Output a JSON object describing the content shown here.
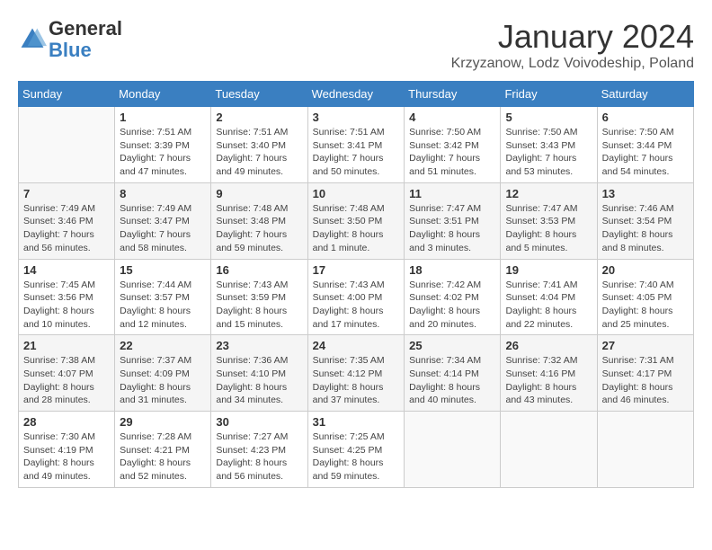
{
  "header": {
    "logo_general": "General",
    "logo_blue": "Blue",
    "month_title": "January 2024",
    "location": "Krzyzanow, Lodz Voivodeship, Poland"
  },
  "weekdays": [
    "Sunday",
    "Monday",
    "Tuesday",
    "Wednesday",
    "Thursday",
    "Friday",
    "Saturday"
  ],
  "weeks": [
    [
      {
        "day": "",
        "sunrise": "",
        "sunset": "",
        "daylight": ""
      },
      {
        "day": "1",
        "sunrise": "Sunrise: 7:51 AM",
        "sunset": "Sunset: 3:39 PM",
        "daylight": "Daylight: 7 hours and 47 minutes."
      },
      {
        "day": "2",
        "sunrise": "Sunrise: 7:51 AM",
        "sunset": "Sunset: 3:40 PM",
        "daylight": "Daylight: 7 hours and 49 minutes."
      },
      {
        "day": "3",
        "sunrise": "Sunrise: 7:51 AM",
        "sunset": "Sunset: 3:41 PM",
        "daylight": "Daylight: 7 hours and 50 minutes."
      },
      {
        "day": "4",
        "sunrise": "Sunrise: 7:50 AM",
        "sunset": "Sunset: 3:42 PM",
        "daylight": "Daylight: 7 hours and 51 minutes."
      },
      {
        "day": "5",
        "sunrise": "Sunrise: 7:50 AM",
        "sunset": "Sunset: 3:43 PM",
        "daylight": "Daylight: 7 hours and 53 minutes."
      },
      {
        "day": "6",
        "sunrise": "Sunrise: 7:50 AM",
        "sunset": "Sunset: 3:44 PM",
        "daylight": "Daylight: 7 hours and 54 minutes."
      }
    ],
    [
      {
        "day": "7",
        "sunrise": "Sunrise: 7:49 AM",
        "sunset": "Sunset: 3:46 PM",
        "daylight": "Daylight: 7 hours and 56 minutes."
      },
      {
        "day": "8",
        "sunrise": "Sunrise: 7:49 AM",
        "sunset": "Sunset: 3:47 PM",
        "daylight": "Daylight: 7 hours and 58 minutes."
      },
      {
        "day": "9",
        "sunrise": "Sunrise: 7:48 AM",
        "sunset": "Sunset: 3:48 PM",
        "daylight": "Daylight: 7 hours and 59 minutes."
      },
      {
        "day": "10",
        "sunrise": "Sunrise: 7:48 AM",
        "sunset": "Sunset: 3:50 PM",
        "daylight": "Daylight: 8 hours and 1 minute."
      },
      {
        "day": "11",
        "sunrise": "Sunrise: 7:47 AM",
        "sunset": "Sunset: 3:51 PM",
        "daylight": "Daylight: 8 hours and 3 minutes."
      },
      {
        "day": "12",
        "sunrise": "Sunrise: 7:47 AM",
        "sunset": "Sunset: 3:53 PM",
        "daylight": "Daylight: 8 hours and 5 minutes."
      },
      {
        "day": "13",
        "sunrise": "Sunrise: 7:46 AM",
        "sunset": "Sunset: 3:54 PM",
        "daylight": "Daylight: 8 hours and 8 minutes."
      }
    ],
    [
      {
        "day": "14",
        "sunrise": "Sunrise: 7:45 AM",
        "sunset": "Sunset: 3:56 PM",
        "daylight": "Daylight: 8 hours and 10 minutes."
      },
      {
        "day": "15",
        "sunrise": "Sunrise: 7:44 AM",
        "sunset": "Sunset: 3:57 PM",
        "daylight": "Daylight: 8 hours and 12 minutes."
      },
      {
        "day": "16",
        "sunrise": "Sunrise: 7:43 AM",
        "sunset": "Sunset: 3:59 PM",
        "daylight": "Daylight: 8 hours and 15 minutes."
      },
      {
        "day": "17",
        "sunrise": "Sunrise: 7:43 AM",
        "sunset": "Sunset: 4:00 PM",
        "daylight": "Daylight: 8 hours and 17 minutes."
      },
      {
        "day": "18",
        "sunrise": "Sunrise: 7:42 AM",
        "sunset": "Sunset: 4:02 PM",
        "daylight": "Daylight: 8 hours and 20 minutes."
      },
      {
        "day": "19",
        "sunrise": "Sunrise: 7:41 AM",
        "sunset": "Sunset: 4:04 PM",
        "daylight": "Daylight: 8 hours and 22 minutes."
      },
      {
        "day": "20",
        "sunrise": "Sunrise: 7:40 AM",
        "sunset": "Sunset: 4:05 PM",
        "daylight": "Daylight: 8 hours and 25 minutes."
      }
    ],
    [
      {
        "day": "21",
        "sunrise": "Sunrise: 7:38 AM",
        "sunset": "Sunset: 4:07 PM",
        "daylight": "Daylight: 8 hours and 28 minutes."
      },
      {
        "day": "22",
        "sunrise": "Sunrise: 7:37 AM",
        "sunset": "Sunset: 4:09 PM",
        "daylight": "Daylight: 8 hours and 31 minutes."
      },
      {
        "day": "23",
        "sunrise": "Sunrise: 7:36 AM",
        "sunset": "Sunset: 4:10 PM",
        "daylight": "Daylight: 8 hours and 34 minutes."
      },
      {
        "day": "24",
        "sunrise": "Sunrise: 7:35 AM",
        "sunset": "Sunset: 4:12 PM",
        "daylight": "Daylight: 8 hours and 37 minutes."
      },
      {
        "day": "25",
        "sunrise": "Sunrise: 7:34 AM",
        "sunset": "Sunset: 4:14 PM",
        "daylight": "Daylight: 8 hours and 40 minutes."
      },
      {
        "day": "26",
        "sunrise": "Sunrise: 7:32 AM",
        "sunset": "Sunset: 4:16 PM",
        "daylight": "Daylight: 8 hours and 43 minutes."
      },
      {
        "day": "27",
        "sunrise": "Sunrise: 7:31 AM",
        "sunset": "Sunset: 4:17 PM",
        "daylight": "Daylight: 8 hours and 46 minutes."
      }
    ],
    [
      {
        "day": "28",
        "sunrise": "Sunrise: 7:30 AM",
        "sunset": "Sunset: 4:19 PM",
        "daylight": "Daylight: 8 hours and 49 minutes."
      },
      {
        "day": "29",
        "sunrise": "Sunrise: 7:28 AM",
        "sunset": "Sunset: 4:21 PM",
        "daylight": "Daylight: 8 hours and 52 minutes."
      },
      {
        "day": "30",
        "sunrise": "Sunrise: 7:27 AM",
        "sunset": "Sunset: 4:23 PM",
        "daylight": "Daylight: 8 hours and 56 minutes."
      },
      {
        "day": "31",
        "sunrise": "Sunrise: 7:25 AM",
        "sunset": "Sunset: 4:25 PM",
        "daylight": "Daylight: 8 hours and 59 minutes."
      },
      {
        "day": "",
        "sunrise": "",
        "sunset": "",
        "daylight": ""
      },
      {
        "day": "",
        "sunrise": "",
        "sunset": "",
        "daylight": ""
      },
      {
        "day": "",
        "sunrise": "",
        "sunset": "",
        "daylight": ""
      }
    ]
  ]
}
